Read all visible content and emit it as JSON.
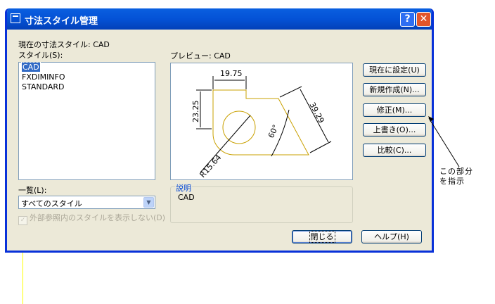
{
  "window": {
    "title": "寸法スタイル管理",
    "help_glyph": "?",
    "close_glyph": "✕"
  },
  "current_style_label": "現在の寸法スタイル: CAD",
  "styles_label": "スタイル(S):",
  "styles": [
    "CAD",
    "FXDIMINFO",
    "STANDARD"
  ],
  "selected_style": "CAD",
  "list_filter": {
    "label": "一覧(L):",
    "value": "すべてのスタイル"
  },
  "xref_checkbox": {
    "label": "外部参照内のスタイルを表示しない(D)",
    "checked": true,
    "enabled": false
  },
  "preview_label": "プレビュー: CAD",
  "preview": {
    "dim_top": "19.75",
    "dim_left": "23.25",
    "dim_right": "39.29",
    "dim_angle": "60°",
    "dim_radius": "R15.64"
  },
  "description": {
    "legend": "説明",
    "text": "CAD"
  },
  "buttons": {
    "set_current": "現在に設定(U)",
    "new": "新規作成(N)...",
    "modify": "修正(M)...",
    "override": "上書き(O)...",
    "compare": "比較(C)...",
    "close": "閉じる",
    "help": "ヘルプ(H)"
  },
  "annotation": {
    "line1": "この部分",
    "line2": "を指示"
  },
  "colors": {
    "titlebar": "#0452d6",
    "face": "#ece9d8",
    "selection": "#316ac5",
    "guide_line": "#ffff00"
  }
}
